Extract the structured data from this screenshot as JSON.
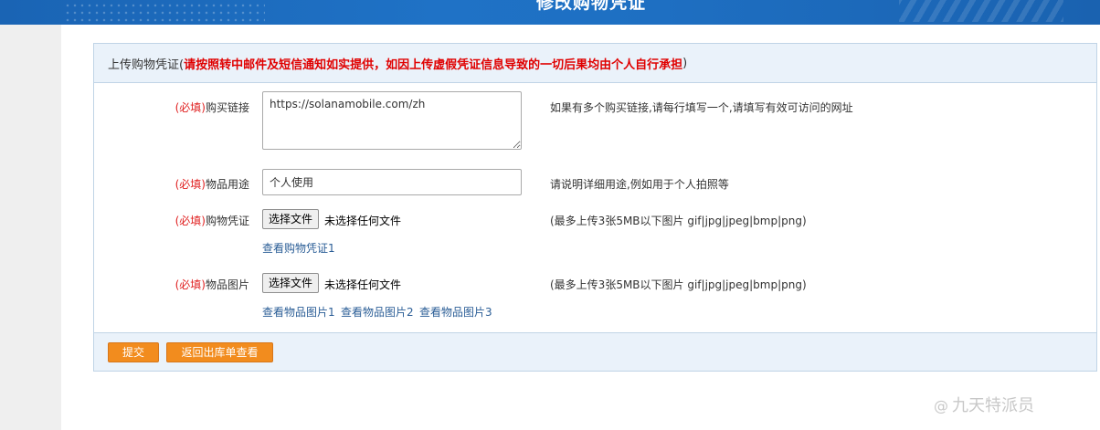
{
  "banner": {
    "title": "修改购物凭证"
  },
  "panel": {
    "header_prefix": "上传购物凭证(",
    "header_warning": "请按照转中邮件及短信通知如实提供，如因上传虚假凭证信息导致的一切后果均由个人自行承担",
    "header_suffix": ")"
  },
  "form": {
    "required_tag": "(必填)",
    "purchase_link": {
      "label": "购买链接",
      "value": "https://solanamobile.com/zh",
      "hint": "如果有多个购买链接,请每行填写一个,请填写有效可访问的网址"
    },
    "usage": {
      "label": "物品用途",
      "value": "个人使用",
      "hint": "请说明详细用途,例如用于个人拍照等"
    },
    "receipt": {
      "label": "购物凭证",
      "button": "选择文件",
      "status": "未选择任何文件",
      "hint": "(最多上传3张5MB以下图片 gif|jpg|jpeg|bmp|png)",
      "links": [
        "查看购物凭证1"
      ]
    },
    "item_images": {
      "label": "物品图片",
      "button": "选择文件",
      "status": "未选择任何文件",
      "hint": "(最多上传3张5MB以下图片 gif|jpg|jpeg|bmp|png)",
      "links": [
        "查看物品图片1",
        "查看物品图片2",
        "查看物品图片3"
      ]
    }
  },
  "footer": {
    "submit_label": "提交",
    "back_label": "返回出库单查看"
  },
  "watermark": {
    "text": "九天特派员",
    "icon": "at-sign-icon"
  },
  "colors": {
    "banner": "#1e6fc2",
    "warning": "#e00000",
    "accent_button": "#f28c1e",
    "link": "#2a5d96"
  }
}
